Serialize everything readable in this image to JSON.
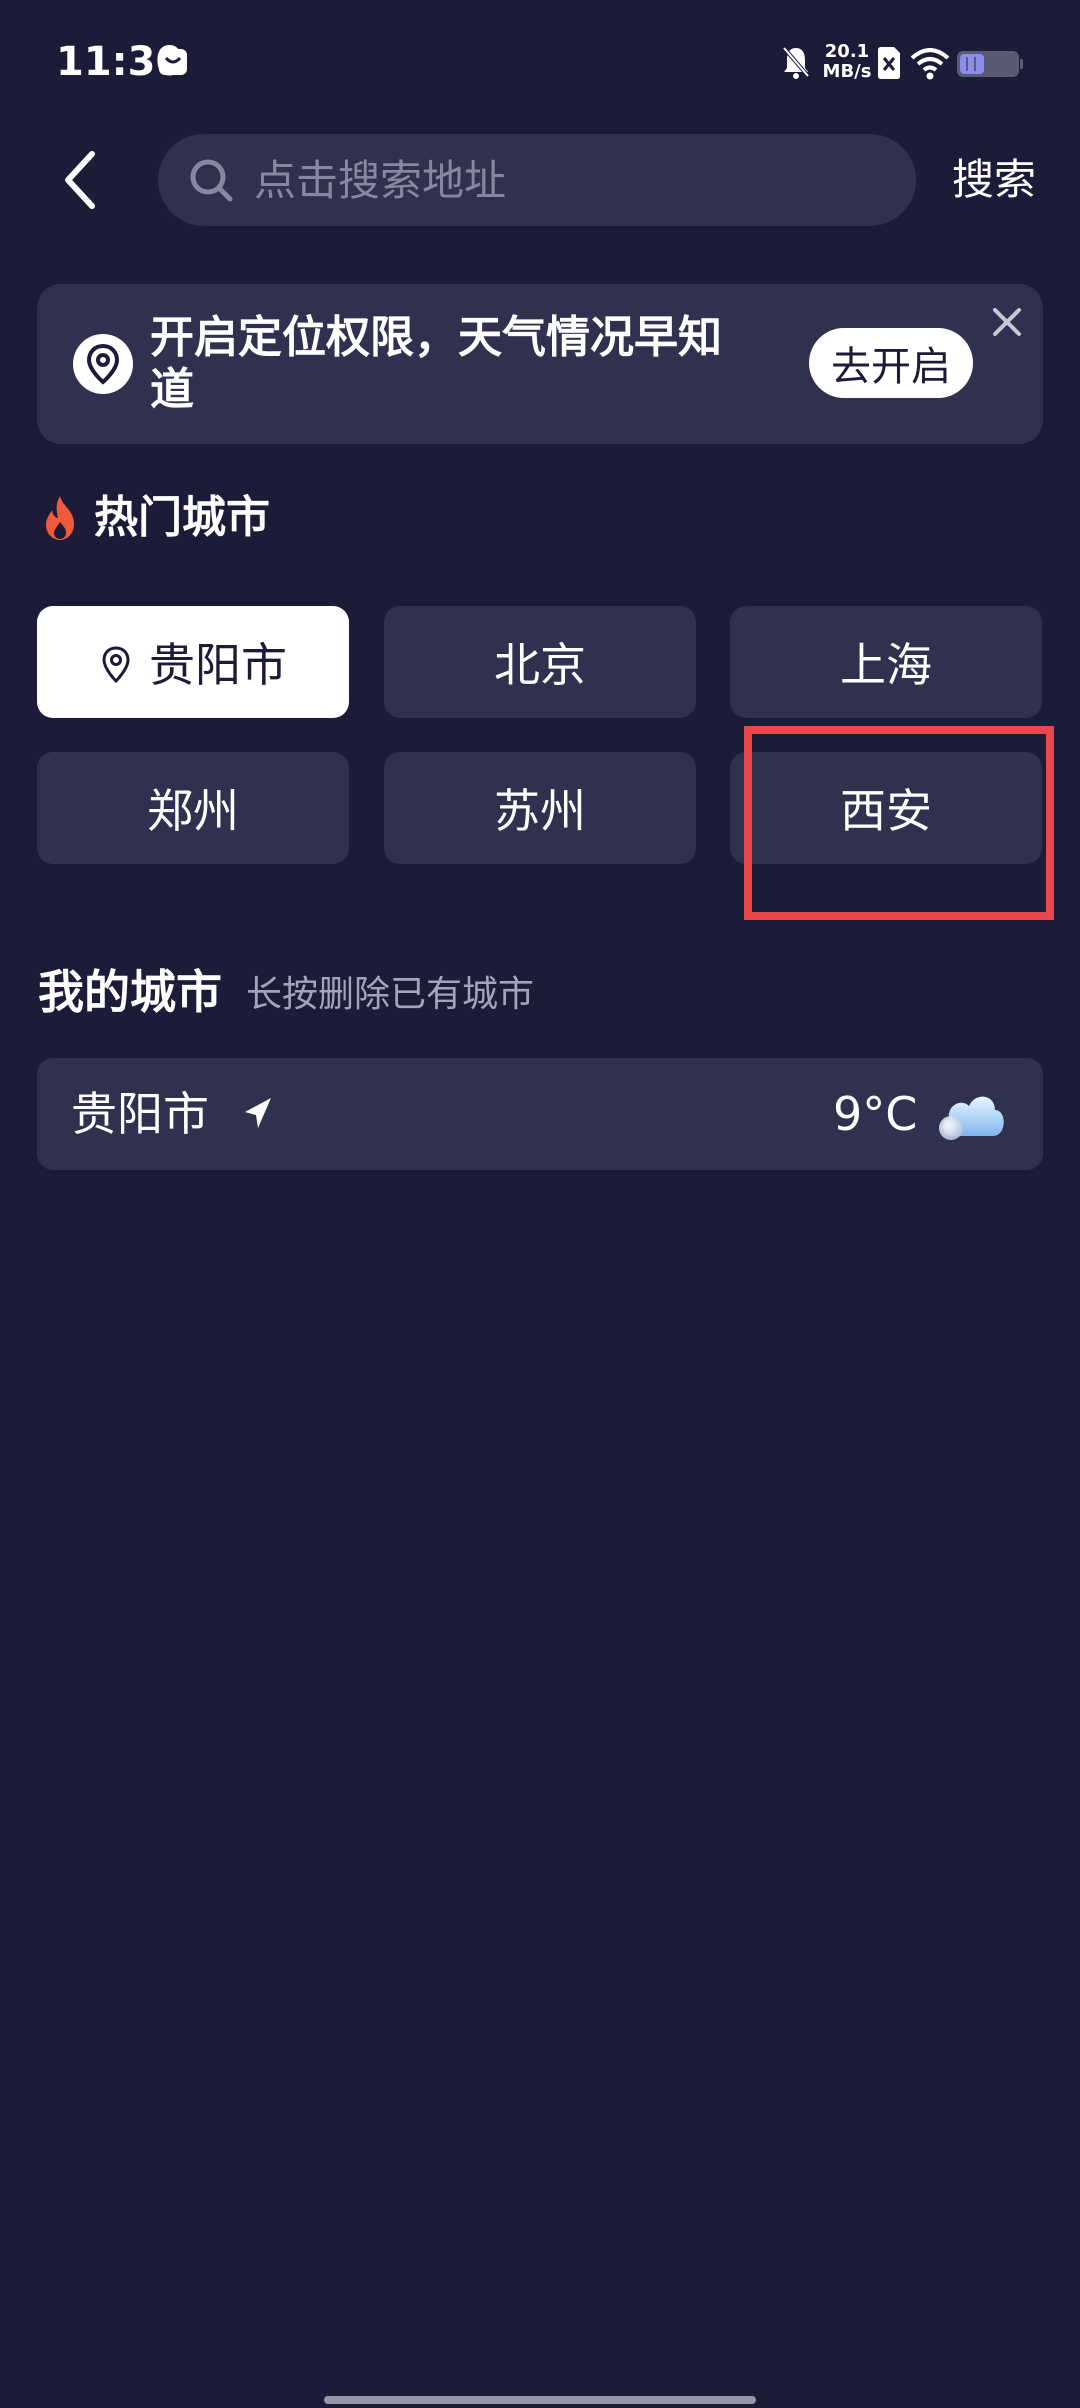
{
  "status_bar": {
    "time": "11:30",
    "net_speed_value": "20.1",
    "net_speed_unit": "MB/s",
    "icons": [
      "message-icon",
      "mute-bell-icon",
      "sim-x-icon",
      "wifi-icon",
      "battery-icon"
    ]
  },
  "header": {
    "search_placeholder": "点击搜索地址",
    "search_button": "搜索"
  },
  "banner": {
    "text": "开启定位权限，天气情况早知道",
    "open_button": "去开启"
  },
  "hot_cities": {
    "title": "热门城市",
    "cities": [
      {
        "name": "贵阳市",
        "selected": true
      },
      {
        "name": "北京",
        "selected": false
      },
      {
        "name": "上海",
        "selected": false
      },
      {
        "name": "郑州",
        "selected": false
      },
      {
        "name": "苏州",
        "selected": false
      },
      {
        "name": "西安",
        "selected": false
      }
    ]
  },
  "my_cities": {
    "title": "我的城市",
    "hint": "长按删除已有城市",
    "items": [
      {
        "name": "贵阳市",
        "temperature": "9°C",
        "weather_icon": "cloudy-icon"
      }
    ]
  },
  "colors": {
    "background": "#1c1c39",
    "card": "#30304f",
    "highlight": "#e8474c",
    "fire": "#ef5a3a"
  }
}
